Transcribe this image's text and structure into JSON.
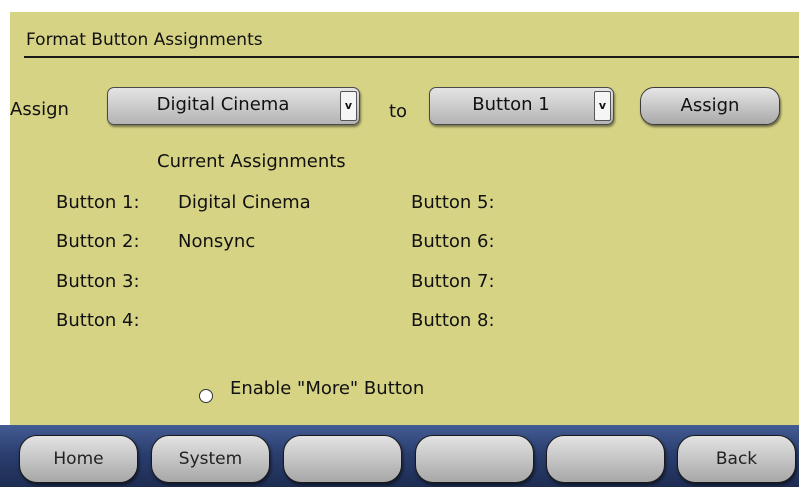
{
  "header": {
    "title": "Format Button Assignments"
  },
  "assign_row": {
    "assign_label": "Assign",
    "format_select": {
      "value": "Digital Cinema",
      "arrow": "v"
    },
    "to_label": "to",
    "button_select": {
      "value": "Button 1",
      "arrow": "v"
    },
    "assign_button": "Assign"
  },
  "assignments": {
    "heading": "Current Assignments",
    "left": [
      {
        "label": "Button 1:",
        "value": "Digital Cinema"
      },
      {
        "label": "Button 2:",
        "value": "Nonsync"
      },
      {
        "label": "Button 3:",
        "value": ""
      },
      {
        "label": "Button 4:",
        "value": ""
      }
    ],
    "right": [
      {
        "label": "Button 5:",
        "value": ""
      },
      {
        "label": "Button 6:",
        "value": ""
      },
      {
        "label": "Button 7:",
        "value": ""
      },
      {
        "label": "Button 8:",
        "value": ""
      }
    ]
  },
  "more_option": {
    "label": "Enable \"More\" Button",
    "checked": false
  },
  "bottom_nav": [
    "Home",
    "System",
    "",
    "",
    "",
    "Back"
  ],
  "colors": {
    "panel": "#d6d385",
    "nav_bar": "#2b3f70",
    "button_face": "#c8c8c8"
  }
}
